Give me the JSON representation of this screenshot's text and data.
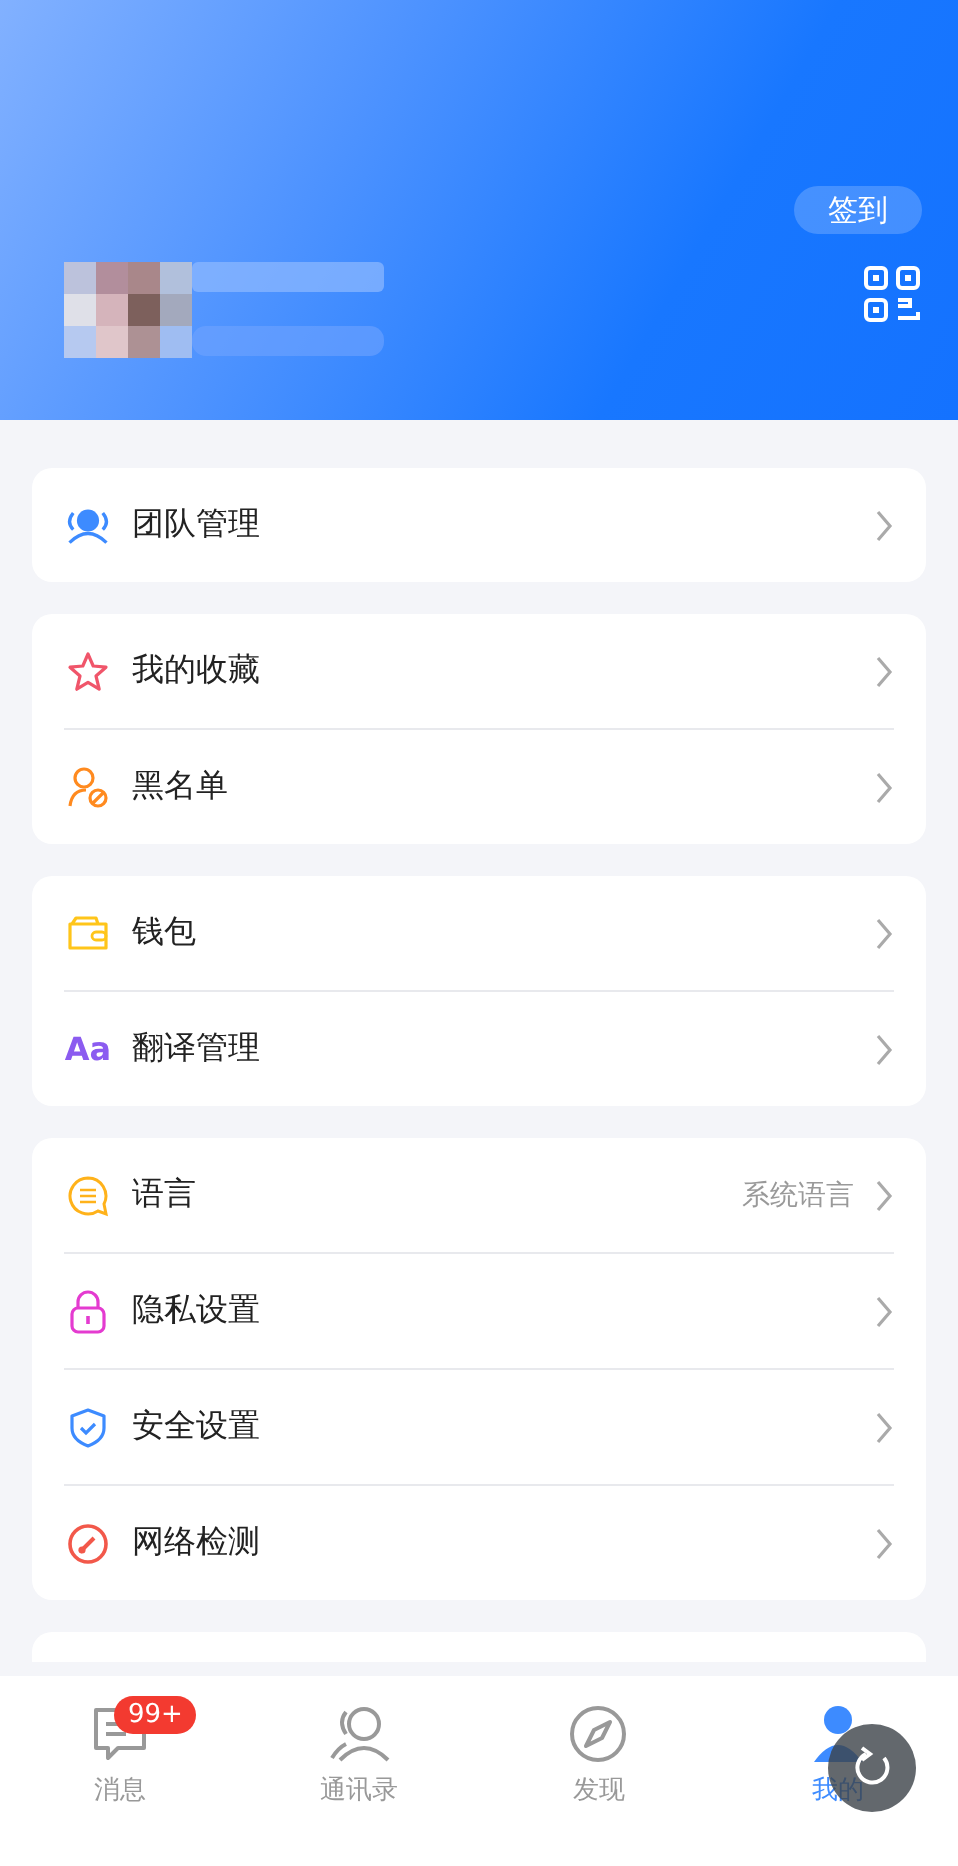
{
  "header": {
    "checkin_button": "签到"
  },
  "sections": [
    {
      "items": [
        {
          "label": "团队管理"
        }
      ]
    },
    {
      "items": [
        {
          "label": "我的收藏"
        },
        {
          "label": "黑名单"
        }
      ]
    },
    {
      "items": [
        {
          "label": "钱包"
        },
        {
          "label": "翻译管理",
          "icon_text": "Aa"
        }
      ]
    },
    {
      "items": [
        {
          "label": "语言",
          "value": "系统语言"
        },
        {
          "label": "隐私设置"
        },
        {
          "label": "安全设置"
        },
        {
          "label": "网络检测"
        }
      ]
    }
  ],
  "tab_bar": [
    {
      "label": "消息",
      "selected": false,
      "badge": "99+"
    },
    {
      "label": "通讯录",
      "selected": false
    },
    {
      "label": "发现",
      "selected": false
    },
    {
      "label": "我的",
      "selected": true
    }
  ]
}
